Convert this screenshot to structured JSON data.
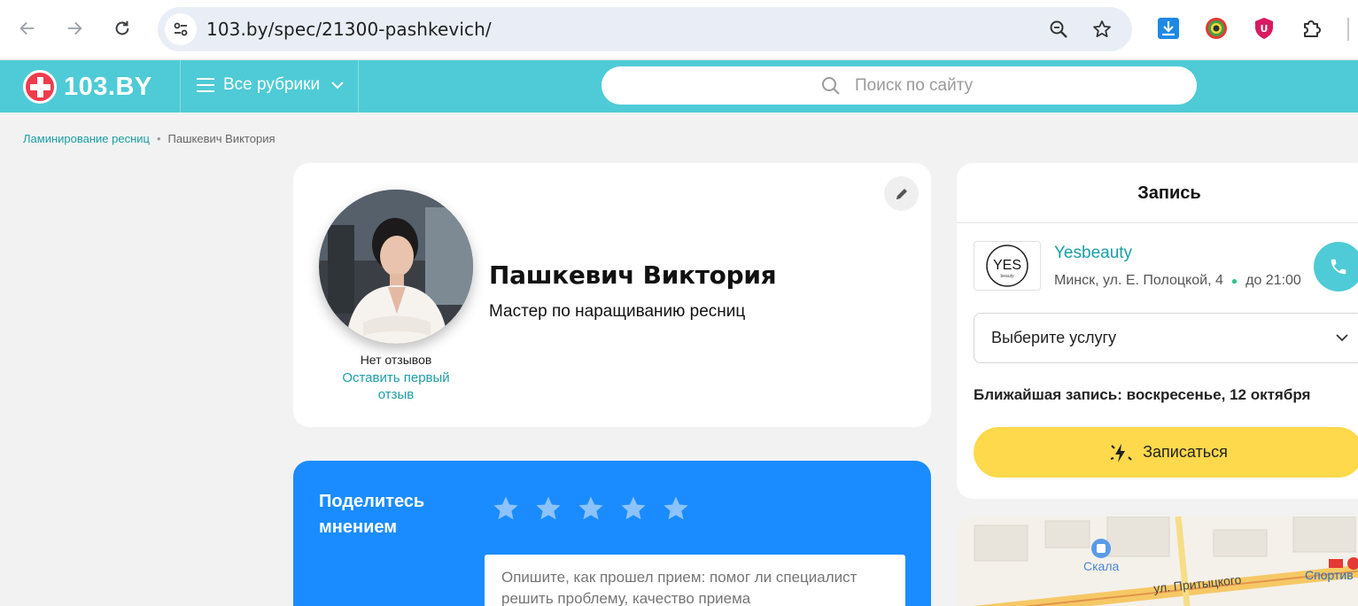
{
  "browser": {
    "url": "103.by/spec/21300-pashkevich/",
    "back_icon": "arrow-left-icon",
    "forward_icon": "arrow-right-icon",
    "reload_icon": "reload-icon"
  },
  "site": {
    "logo_text": "103.BY",
    "rubrics_label": "Все рубрики",
    "search_placeholder": "Поиск по сайту",
    "brand_color": "#4ecbd6"
  },
  "breadcrumb": {
    "parent": "Ламинирование ресниц",
    "current": "Пашкевич Виктория"
  },
  "profile": {
    "name": "Пашкевич Виктория",
    "role": "Мастер по наращиванию ресниц",
    "reviews_status": "Нет отзывов",
    "first_review_link": "Оставить первый отзыв"
  },
  "review": {
    "title": "Поделитесь мнением",
    "stars": 5,
    "placeholder": "Опишите, как прошел прием: помог ли специалист решить проблему, качество приема"
  },
  "booking": {
    "title": "Запись",
    "salon_logo_text": "YES",
    "salon_logo_subtext": "beauty",
    "salon_name": "Yesbeauty",
    "address": "Минск, ул. Е. Полоцкой, 4",
    "hours": "до 21:00",
    "service_select": "Выберите услугу",
    "nearest": "Ближайшая запись: воскресенье, 12 октября",
    "book_button": "Записаться",
    "button_color": "#fed94b"
  },
  "map": {
    "place": "Скала",
    "street": "ул. Притыцкого",
    "right_label": "Спортив"
  }
}
